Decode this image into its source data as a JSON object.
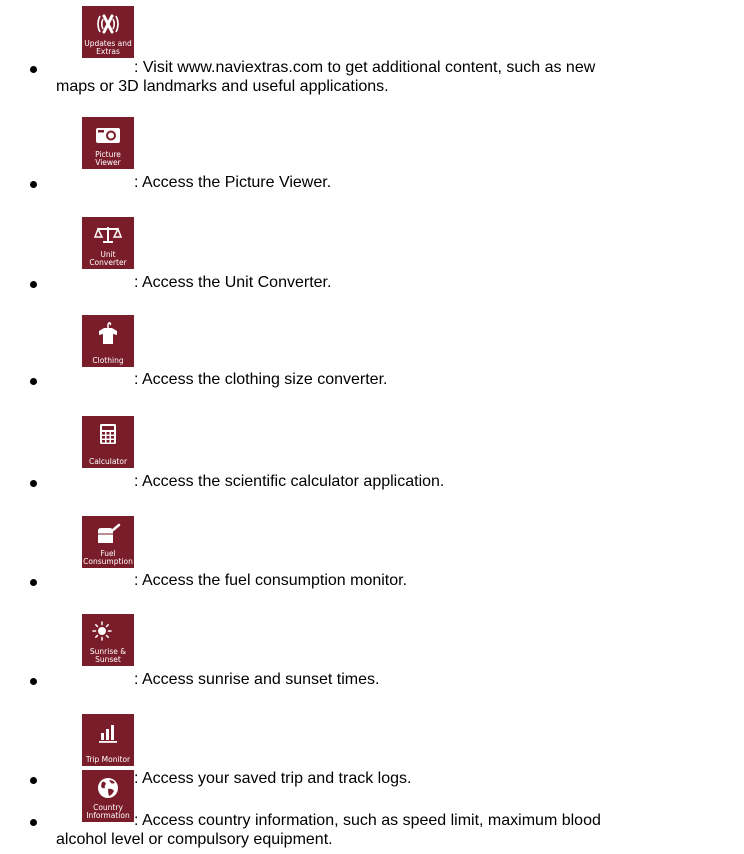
{
  "tile_color": "#7a1d2a",
  "items": [
    {
      "icon": "updates-extras-icon",
      "tile_label": "Updates and\nExtras",
      "text_line1": ": Visit www.naviextras.com to get additional content, such as new",
      "text_line2": "maps or 3D landmarks and useful applications."
    },
    {
      "icon": "camera-icon",
      "tile_label": "Picture Viewer",
      "text_line1": ": Access the Picture Viewer."
    },
    {
      "icon": "scales-icon",
      "tile_label": "Unit Converter",
      "text_line1": ": Access the Unit Converter."
    },
    {
      "icon": "shirt-on-hanger-icon",
      "tile_label": "Clothing",
      "text_line1": ": Access the clothing size converter."
    },
    {
      "icon": "calculator-icon",
      "tile_label": "Calculator",
      "text_line1": ": Access the scientific calculator application."
    },
    {
      "icon": "fuel-can-icon",
      "tile_label": "Fuel\nConsumption",
      "text_line1": ": Access the fuel consumption monitor."
    },
    {
      "icon": "sun-moon-icon",
      "tile_label": "Sunrise &\nSunset",
      "text_line1": ": Access sunrise and sunset times."
    },
    {
      "icon": "bar-chart-icon",
      "tile_label": "Trip Monitor",
      "text_line1": ": Access your saved trip and track logs."
    },
    {
      "icon": "globe-icon",
      "tile_label": "Country\nInformation",
      "text_line1": ": Access country information, such as speed limit, maximum blood",
      "text_line2": "alcohol level or compulsory equipment."
    }
  ]
}
